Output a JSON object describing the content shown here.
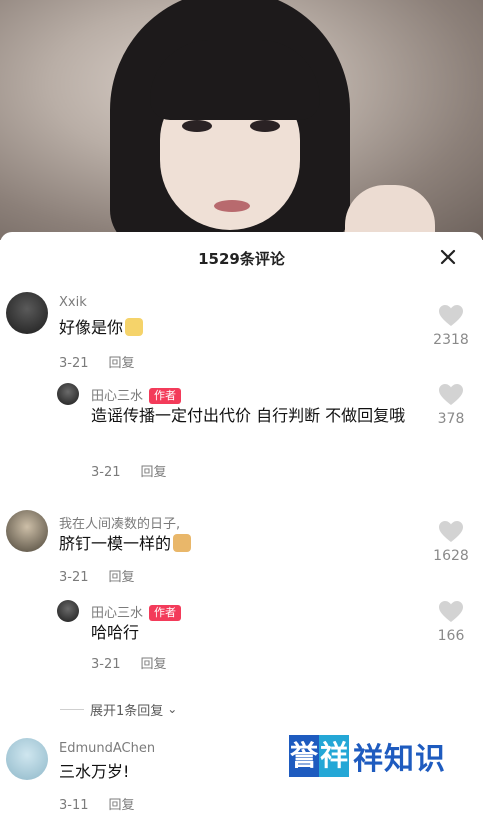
{
  "header": {
    "title": "1529条评论",
    "close_icon": "close-icon"
  },
  "comments": [
    {
      "user": "Xxik",
      "text": "好像是你",
      "date": "3-21",
      "reply_label": "回复",
      "likes": "2318",
      "replies": [
        {
          "user": "田心三水",
          "badge": "作者",
          "text": "造谣传播一定付出代价 自行判断 不做回复哦",
          "date": "3-21",
          "reply_label": "回复",
          "likes": "378"
        }
      ]
    },
    {
      "user": "我在人间凑数的日子,",
      "text": "脐钉一模一样的",
      "date": "3-21",
      "reply_label": "回复",
      "likes": "1628",
      "replies": [
        {
          "user": "田心三水",
          "badge": "作者",
          "text": "哈哈行",
          "date": "3-21",
          "reply_label": "回复",
          "likes": "166"
        }
      ]
    },
    {
      "user": "EdmundAChen",
      "text": "三水万岁!",
      "date": "3-11",
      "reply_label": "回复"
    }
  ],
  "expand_replies": "展开1条回复",
  "watermark": {
    "box1": "誉",
    "box2": "祥",
    "text": "祥知识"
  },
  "colors": {
    "badge": "#f33b5a",
    "watermark_blue": "#1e5bbf",
    "watermark_cyan": "#24a7d6"
  }
}
